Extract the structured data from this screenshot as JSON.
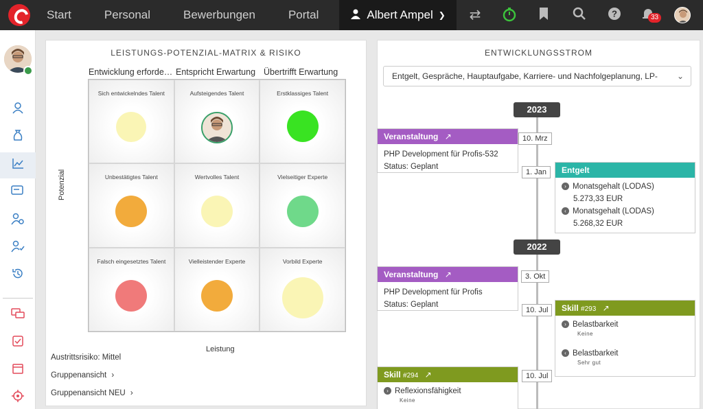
{
  "topbar": {
    "nav": [
      "Start",
      "Personal",
      "Bewerbungen",
      "Portal"
    ],
    "user_name": "Albert Ampel",
    "notification_count": "33",
    "icons": [
      "swap-icon",
      "stopwatch-icon",
      "bookmark-icon",
      "search-icon",
      "help-icon",
      "bell-icon"
    ],
    "stopwatch_color": "#3cc33c"
  },
  "matrix": {
    "title": "LEISTUNGS-POTENZIAL-MATRIX & RISIKO",
    "columns": [
      "Entwicklung erforde…",
      "Entspricht Erwartung",
      "Übertrifft Erwartung"
    ],
    "cells": [
      {
        "label": "Sich entwickelndes Talent",
        "color": "#faf5b5"
      },
      {
        "label": "Aufsteigendes Talent",
        "color": "avatar"
      },
      {
        "label": "Erstklassiges Talent",
        "color": "#39e322"
      },
      {
        "label": "Unbestätigtes Talent",
        "color": "#f2ab3c"
      },
      {
        "label": "Wertvolles Talent",
        "color": "#faf5b5"
      },
      {
        "label": "Vielseitiger Experte",
        "color": "#6fd98a"
      },
      {
        "label": "Falsch eingesetztes Talent",
        "color": "#f07a7a"
      },
      {
        "label": "Vielleistender Experte",
        "color": "#f2ab3c"
      },
      {
        "label": "Vorbild Experte",
        "color": "#faf5b5"
      }
    ],
    "y_label": "Potenzial",
    "x_label": "Leistung",
    "risk": "Austrittsrisiko: Mittel",
    "link1": "Gruppenansicht",
    "link2": "Gruppenansicht NEU"
  },
  "stream": {
    "title": "ENTWICKLUNGSSTROM",
    "filter": "Entgelt, Gespräche, Hauptaufgabe, Karriere- und Nachfolgeplanung, LP-",
    "year1": "2023",
    "year2": "2022",
    "ev1": {
      "head": "Veranstaltung",
      "date": "10. Mrz",
      "line1": "PHP Development für Profis-532",
      "line2": "Status: Geplant"
    },
    "ev2": {
      "head": "Entgelt",
      "date": "1. Jan",
      "item1": "Monatsgehalt (LODAS)",
      "val1": "5.273,33 EUR",
      "item2": "Monatsgehalt (LODAS)",
      "val2": "5.268,32 EUR"
    },
    "ev3": {
      "head": "Veranstaltung",
      "date": "3. Okt",
      "line1": "PHP Development für Profis",
      "line2": "Status: Geplant"
    },
    "ev4": {
      "head": "Skill",
      "num": "#293",
      "date": "10. Jul",
      "item1": "Belastbarkeit",
      "sub1": "Keine",
      "item2": "Belastbarkeit",
      "sub2": "Sehr gut"
    },
    "ev5": {
      "head": "Skill",
      "num": "#294",
      "date": "10. Jul",
      "item1": "Reflexionsfähigkeit",
      "sub1": "Keine"
    }
  }
}
